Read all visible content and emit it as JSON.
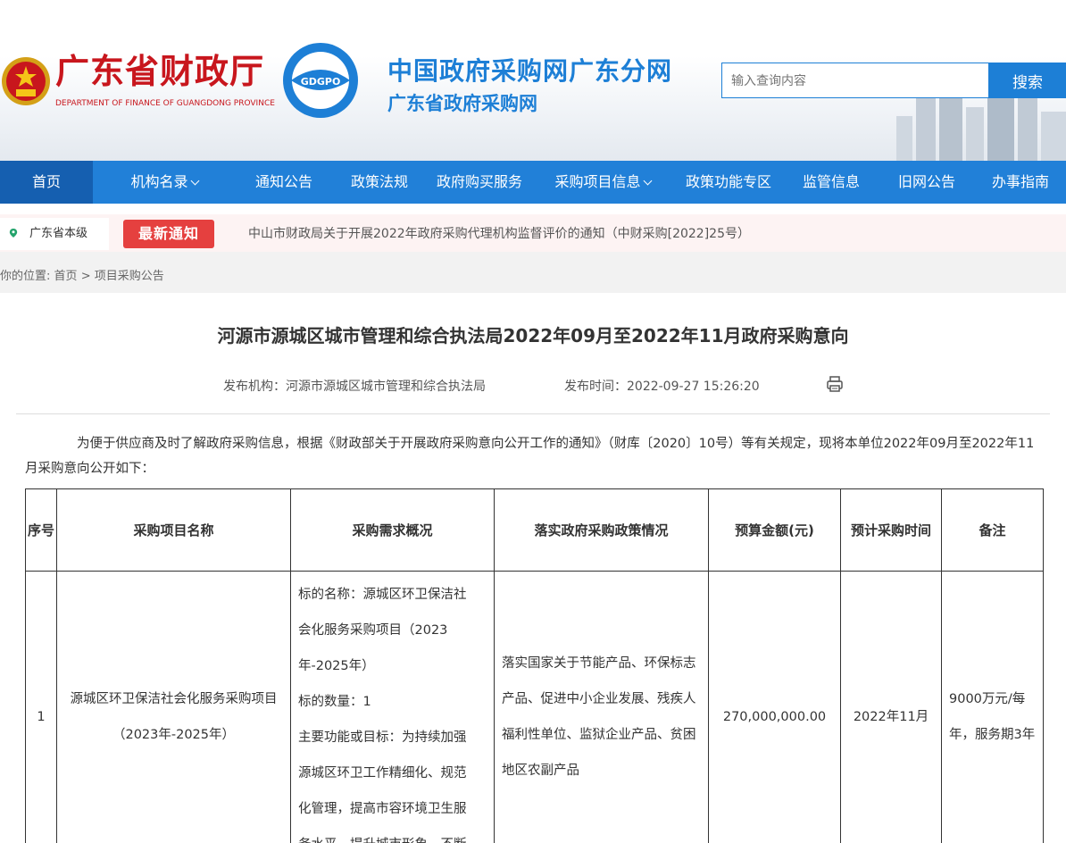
{
  "header": {
    "dept_name_cn": "广东省财政厅",
    "dept_name_en": "DEPARTMENT OF FINANCE OF GUANGDONG PROVINCE",
    "logo_text": "GDGPO",
    "site_title": "中国政府采购网广东分网",
    "site_subtitle": "广东省政府采购网",
    "search_placeholder": "输入查询内容",
    "search_button": "搜索"
  },
  "nav": {
    "items": [
      {
        "label": "首页"
      },
      {
        "label": "机构名录"
      },
      {
        "label": "通知公告"
      },
      {
        "label": "政策法规"
      },
      {
        "label": "政府购买服务"
      },
      {
        "label": "采购项目信息"
      },
      {
        "label": "政策功能专区"
      },
      {
        "label": "监管信息"
      },
      {
        "label": "旧网公告"
      },
      {
        "label": "办事指南"
      }
    ]
  },
  "notice": {
    "region": "广东省本级",
    "badge": "最新通知",
    "text": "中山市财政局关于开展2022年政府采购代理机构监督评价的通知（中财采购[2022]25号）"
  },
  "breadcrumb": {
    "prefix": "你的位置:",
    "home": "首页",
    "separator": ">",
    "current": "项目采购公告"
  },
  "article": {
    "title": "河源市源城区城市管理和综合执法局2022年09月至2022年11月政府采购意向",
    "publisher_label": "发布机构：",
    "publisher": "河源市源城区城市管理和综合执法局",
    "time_label": "发布时间：",
    "time": "2022-09-27 15:26:20",
    "intro": "为便于供应商及时了解政府采购信息，根据《财政部关于开展政府采购意向公开工作的通知》（财库〔2020〕10号）等有关规定，现将本单位2022年09月至2022年11月采购意向公开如下："
  },
  "table": {
    "headers": [
      "序号",
      "采购项目名称",
      "采购需求概况",
      "落实政府采购政策情况",
      "预算金额(元)",
      "预计采购时间",
      "备注"
    ],
    "rows": [
      {
        "no": "1",
        "name": "源城区环卫保洁社会化服务采购项目（2023年-2025年）",
        "demand_lines": [
          "标的名称：源城区环卫保洁社",
          "会化服务采购项目（2023",
          "年-2025年）",
          "标的数量：1",
          "主要功能或目标：为持续加强",
          "源城区环卫工作精细化、规范",
          "化管理，提高市容环境卫生服",
          "务水平，提升城市形象，不断"
        ],
        "policy": "落实国家关于节能产品、环保标志产品、促进中小企业发展、残疾人福利性单位、监狱企业产品、贫困地区农副产品",
        "budget": "270,000,000.00",
        "time": "2022年11月",
        "remark": "9000万元/每年，服务期3年"
      }
    ]
  }
}
